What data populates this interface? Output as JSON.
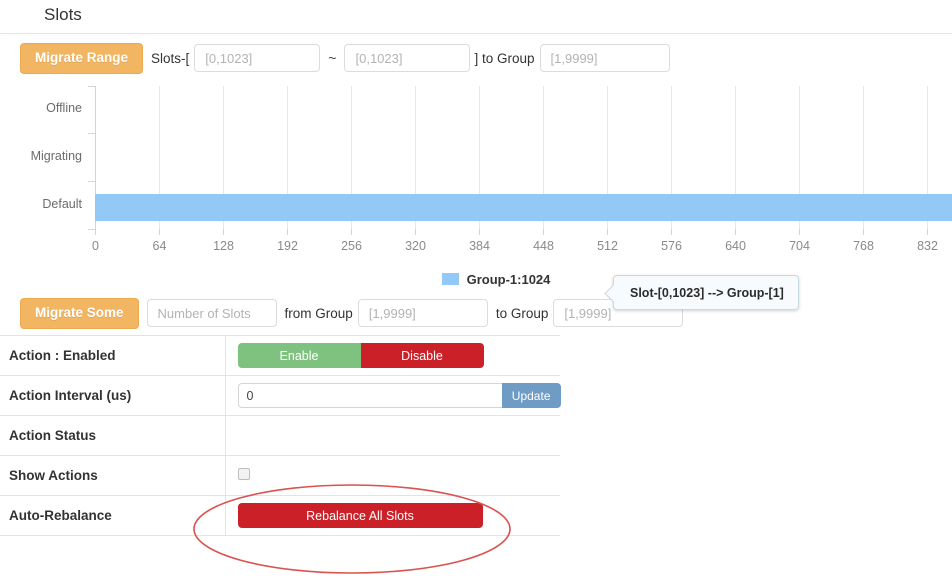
{
  "header": {
    "title": "Slots"
  },
  "migrate_range": {
    "button_label": "Migrate Range",
    "slots_label": "Slots-[",
    "from_placeholder": "[0,1023]",
    "from_value": "",
    "tilde": "~",
    "to_placeholder": "[0,1023]",
    "to_value": "",
    "close_bracket_label": "] to Group",
    "group_placeholder": "[1,9999]",
    "group_value": ""
  },
  "migrate_some": {
    "button_label": "Migrate Some",
    "count_placeholder": "Number of Slots",
    "count_value": "",
    "from_group_label": "from Group",
    "from_group_placeholder": "[1,9999]",
    "from_group_value": "",
    "to_group_label": "to Group",
    "to_group_placeholder": "[1,9999]",
    "to_group_value": ""
  },
  "chart_data": {
    "type": "bar",
    "orientation": "horizontal",
    "title": "",
    "xlabel": "",
    "ylabel": "",
    "categories": [
      "Offline",
      "Migrating",
      "Default"
    ],
    "series": [
      {
        "name": "Group-1:1024",
        "color": "#92c9f7",
        "values": [
          0,
          0,
          1024
        ]
      }
    ],
    "xlim": [
      0,
      896
    ],
    "xticks": [
      0,
      64,
      128,
      192,
      256,
      320,
      384,
      448,
      512,
      576,
      640,
      704,
      768,
      832
    ],
    "grid": true,
    "legend_position": "bottom",
    "legend_entries": [
      "Group-1:1024"
    ],
    "annotations": [
      "Slot-[0,1023] --> Group-[1]"
    ]
  },
  "tooltip": {
    "text": "Slot-[0,1023] --> Group-[1]"
  },
  "legend": {
    "label": "Group-1:1024",
    "color": "#92c9f7"
  },
  "settings": {
    "rows": [
      {
        "label": "Action : Enabled",
        "enable_label": "Enable",
        "disable_label": "Disable"
      },
      {
        "label": "Action Interval (us)",
        "interval_value": "0",
        "update_label": "Update"
      },
      {
        "label": "Action Status",
        "status_value": ""
      },
      {
        "label": "Show Actions",
        "checked": false
      },
      {
        "label": "Auto-Rebalance",
        "rebalance_label": "Rebalance All Slots"
      }
    ]
  },
  "colors": {
    "orange": "#f2b562",
    "bar_blue": "#92c9f7",
    "green": "#7fc17f",
    "red": "#cb2027",
    "update_blue": "#6e9cc4",
    "annotation_red": "#d9534f"
  }
}
